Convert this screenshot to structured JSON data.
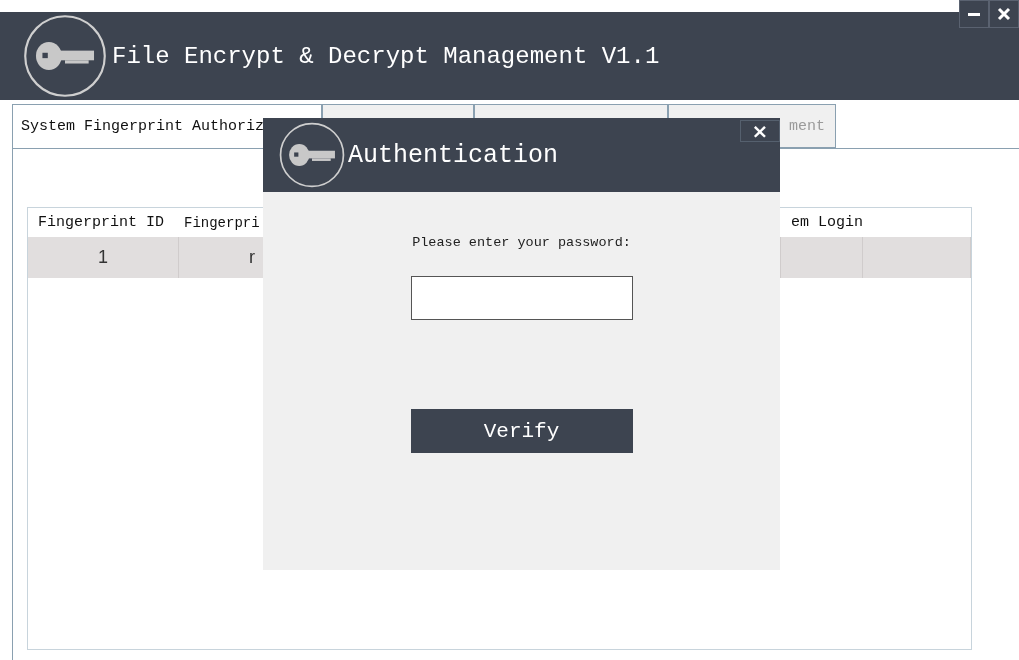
{
  "window": {
    "title": "File Encrypt & Decrypt Management V1.1",
    "controls": [
      {
        "kind": "minimize"
      },
      {
        "kind": "close"
      }
    ]
  },
  "tabs": [
    {
      "label": "System Fingerprint Authoriz",
      "selected": true
    },
    {
      "selected": false
    },
    {
      "selected": false
    },
    {
      "label": "ment",
      "selected": false
    }
  ],
  "table": {
    "columns": [
      "Fingerprint ID",
      "Fingerpri",
      "em Login"
    ],
    "rows": [
      {
        "cells": [
          "1",
          "r"
        ],
        "selected": true
      }
    ]
  },
  "dialog": {
    "title": "Authentication",
    "close": "×",
    "prompt": "Please enter your password:",
    "button": "Verify"
  }
}
